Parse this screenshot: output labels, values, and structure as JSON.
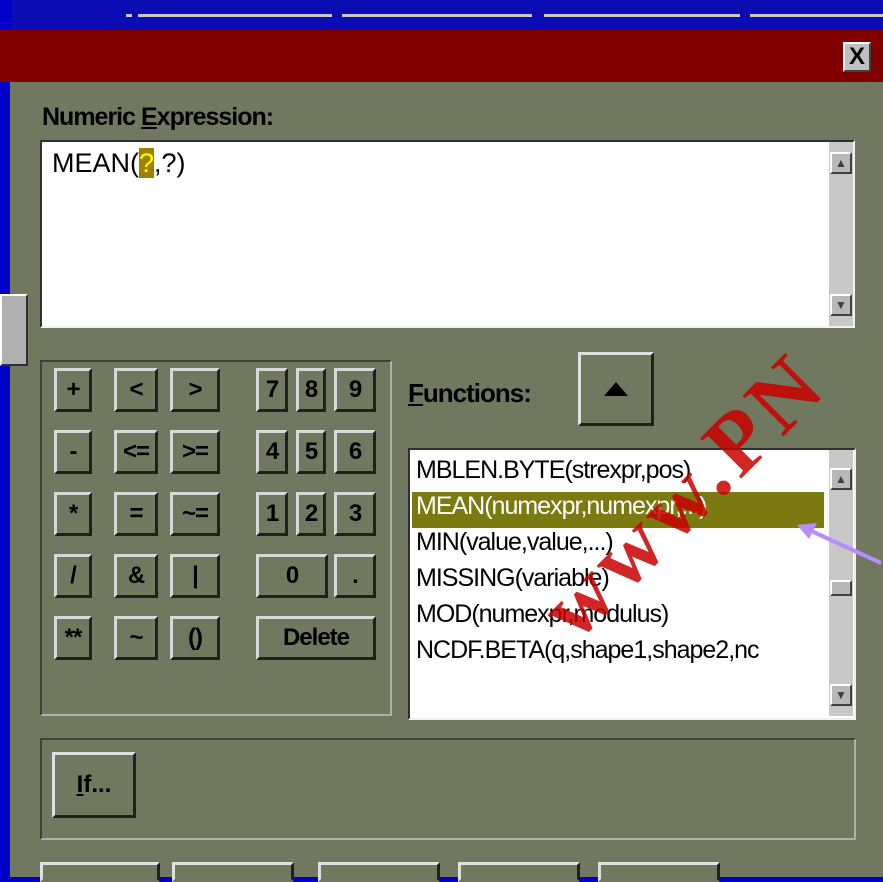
{
  "dialog": {
    "close_label": "X"
  },
  "expression": {
    "label_prefix": "Numeric ",
    "label_accel": "E",
    "label_rest": "xpression:",
    "text_before": "MEAN(",
    "text_highlight": "?",
    "text_after": ",?)"
  },
  "keypad": {
    "keys": [
      "+",
      "<",
      ">",
      "7",
      "8",
      "9",
      "-",
      "<=",
      ">=",
      "4",
      "5",
      "6",
      "*",
      "=",
      "~=",
      "1",
      "2",
      "3",
      "/",
      "&",
      "|",
      "0",
      ".",
      "**",
      "~",
      "()",
      "Delete"
    ]
  },
  "functions": {
    "label_accel": "F",
    "label_rest": "unctions:",
    "items": [
      "MBLEN.BYTE(strexpr,pos)",
      "MEAN(numexpr,numexpr,...)",
      "MIN(value,value,...)",
      "MISSING(variable)",
      "MOD(numexpr,modulus)",
      "NCDF.BETA(q,shape1,shape2,nc"
    ],
    "selected_index": 1
  },
  "if_button": {
    "accel": "I",
    "rest": "f..."
  },
  "watermark": "www.PN",
  "colors": {
    "dialog_bg": "#707860",
    "title_bar": "#800000",
    "screen_bg": "#0000c8",
    "selection": "#7a7a10",
    "watermark": "#c80000",
    "arrow": "#b88cff"
  }
}
